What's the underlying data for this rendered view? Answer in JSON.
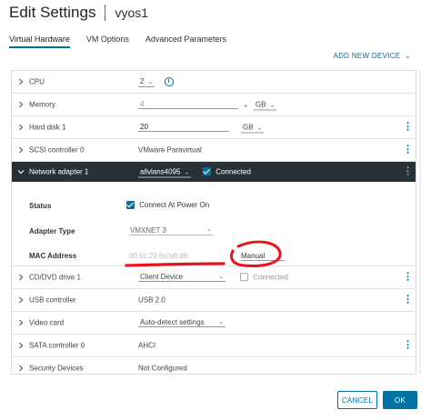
{
  "window": {
    "title": "Edit Settings",
    "vm_name": "vyos1"
  },
  "tabs": [
    {
      "label": "Virtual Hardware"
    },
    {
      "label": "VM Options"
    },
    {
      "label": "Advanced Parameters"
    }
  ],
  "add_device_label": "ADD NEW DEVICE",
  "hardware": {
    "cpu": {
      "label": "CPU",
      "value": "2"
    },
    "memory": {
      "label": "Memory",
      "value": "4",
      "unit": "GB"
    },
    "hard_disk": {
      "label": "Hard disk 1",
      "value": "20",
      "unit": "GB"
    },
    "scsi": {
      "label": "SCSI controller 0",
      "value": "VMware Paravirtual"
    },
    "network": {
      "label": "Network adapter 1",
      "network": "allvlans4095",
      "connected_label": "Connected",
      "connected": true,
      "status_label": "Status",
      "connect_at_power_on_label": "Connect At Power On",
      "connect_at_power_on": true,
      "adapter_type_label": "Adapter Type",
      "adapter_type": "VMXNET 3",
      "mac_label": "MAC Address",
      "mac_value": "00:0c:29:6a:b6:d6",
      "mac_mode": "Manual"
    },
    "cddvd": {
      "label": "CD/DVD drive 1",
      "value": "Client Device",
      "connected_label": "Connected",
      "connected": false
    },
    "usb": {
      "label": "USB controller",
      "value": "USB 2.0"
    },
    "video": {
      "label": "Video card",
      "value": "Auto-detect settings"
    },
    "sata": {
      "label": "SATA controller 0",
      "value": "AHCI"
    },
    "security": {
      "label": "Security Devices",
      "value": "Not Configured"
    }
  },
  "buttons": {
    "cancel": "CANCEL",
    "ok": "OK"
  },
  "colors": {
    "accent": "#0072a3",
    "header_dark": "#263238",
    "annotation_red": "#e8141c"
  }
}
